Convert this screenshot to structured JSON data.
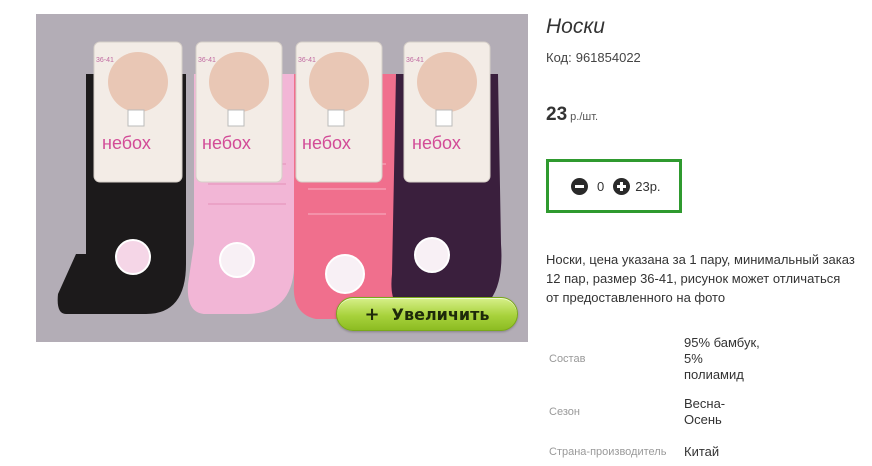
{
  "product": {
    "title": "Носки",
    "code_label": "Код:",
    "code_value": "961854022",
    "price_value": "23",
    "price_unit": "р./шт.",
    "quantity": "0",
    "sum": "23р.",
    "description": "Носки, цена указана за 1 пару, минимальный заказ 12 пар, размер 36-41, рисунок может отличаться от предоставленного на фото"
  },
  "image": {
    "brand": "небох",
    "sizes": [
      "36-41",
      "36-41",
      "36-41",
      "36-41"
    ],
    "sock_colors": [
      "#1c1a1b",
      "#f2b6d6",
      "#f06f8d",
      "#3a1f3d"
    ],
    "zoom_label": "Увеличить",
    "zoom_icon": "+"
  },
  "specs": [
    {
      "key": "Состав",
      "value": "95% бамбук, 5% полиамид"
    },
    {
      "key": "Сезон",
      "value": "Весна-Осень"
    },
    {
      "key": "Страна-производитель",
      "value": "Китай"
    }
  ]
}
